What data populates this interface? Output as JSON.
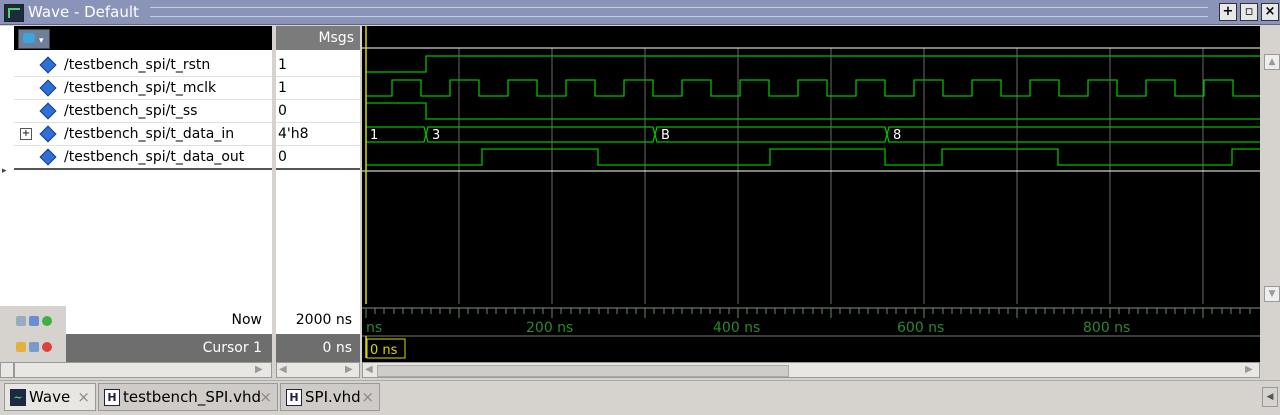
{
  "window": {
    "title": "Wave - Default",
    "buttons": [
      "+",
      "▫",
      "×"
    ]
  },
  "columns": {
    "msgs_header": "Msgs"
  },
  "signals": [
    {
      "name": "/testbench_spi/t_rstn",
      "value": "1",
      "expandable": false
    },
    {
      "name": "/testbench_spi/t_mclk",
      "value": "1",
      "expandable": false
    },
    {
      "name": "/testbench_spi/t_ss",
      "value": "0",
      "expandable": false
    },
    {
      "name": "/testbench_spi/t_data_in",
      "value": "4'h8",
      "expandable": true
    },
    {
      "name": "/testbench_spi/t_data_out",
      "value": "0",
      "expandable": false
    }
  ],
  "bus_labels": [
    "1",
    "3",
    "B",
    "8"
  ],
  "time_axis": [
    "ns",
    "200 ns",
    "400 ns",
    "600 ns",
    "800 ns"
  ],
  "now": {
    "label": "Now",
    "value": "2000 ns"
  },
  "cursor": {
    "label": "Cursor 1",
    "value": "0 ns",
    "readout": "0 ns"
  },
  "tabs": [
    {
      "label": "Wave",
      "icon": "wave-icon",
      "active": true
    },
    {
      "label": "testbench_SPI.vhd",
      "icon": "vhdl-file-icon",
      "active": false
    },
    {
      "label": "SPI.vhd",
      "icon": "vhdl-file-icon",
      "active": false
    }
  ],
  "colors": {
    "wave": "#00c000",
    "cursor": "#d8d800",
    "grid": "#7a7a7a",
    "background": "#000000"
  }
}
